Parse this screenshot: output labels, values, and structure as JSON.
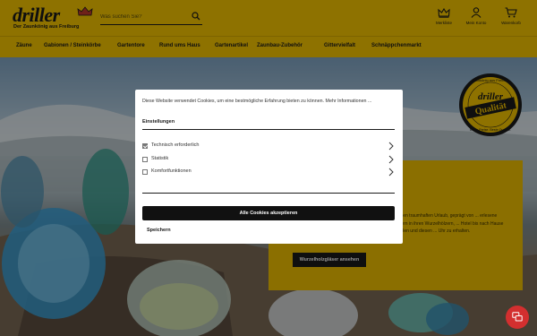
{
  "brand": {
    "logo_text": "driller",
    "tagline": "Der Zaunkönig aus Freiburg"
  },
  "search": {
    "placeholder": "Was suchen Sie?"
  },
  "header_actions": [
    {
      "label": "Merkliste",
      "icon": "crown-icon"
    },
    {
      "label": "Mein Konto",
      "icon": "user-icon"
    },
    {
      "label": "Warenkorb",
      "icon": "cart-icon"
    }
  ],
  "nav": {
    "items": [
      "Zäune",
      "Gabionen / Steinkörbe",
      "Gartentore",
      "Rund ums Haus",
      "Gartenartikel",
      "Zaunbau-Zubehör",
      "Gittervielfalt",
      "Schnäppchenmarkt"
    ]
  },
  "hero": {
    "promo_text": "... einen traumhaften Urlaub, geprägt von ... erlesene Gläsern in ihren Wurzelhölzern, ... Hotel bis nach Hause zu holen und diesen ... Uhr zu erhalten.",
    "button_label": "Wurzelholzgläser ansehen",
    "seal": {
      "top_text": "Zaunkönig aus Freiburg",
      "brand": "driller",
      "main": "Qualität",
      "bottom_text": "Beste Preise. Beste Qualität."
    }
  },
  "cookie_modal": {
    "intro": "Diese Website verwendet Cookies, um eine bestmögliche Erfahrung bieten zu können. Mehr Informationen ...",
    "heading": "Einstellungen",
    "options": [
      {
        "label": "Technisch erforderlich",
        "checked": true
      },
      {
        "label": "Statistik",
        "checked": false
      },
      {
        "label": "Komfortfunktionen",
        "checked": false
      }
    ],
    "accept_all_label": "Alle Cookies akzeptieren",
    "save_label": "Speichern"
  },
  "colors": {
    "brand_yellow": "#f4c400",
    "promo_yellow": "#f0c000",
    "dark": "#111111",
    "chat_red": "#d32f2f"
  }
}
